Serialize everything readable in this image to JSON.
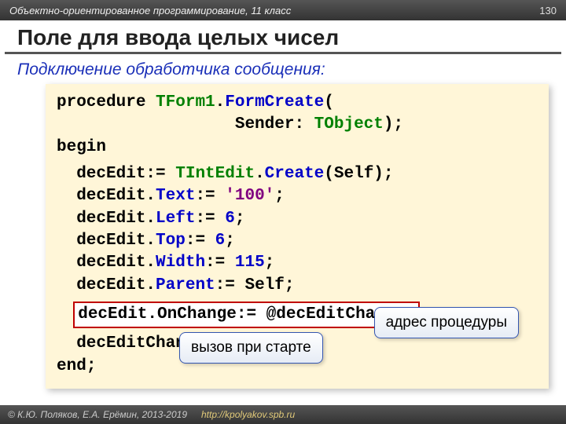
{
  "header": {
    "course": "Объектно-ориентированное программирование, 11 класс",
    "page_number": "130"
  },
  "title": "Поле для ввода целых чисел",
  "subtitle": "Подключение обработчика сообщения:",
  "code": {
    "kw_procedure": "procedure",
    "cls_tform1": "TForm1",
    "meth_formcreate": "FormCreate",
    "open_paren": "(",
    "param_indent": "                  Sender: ",
    "cls_tobject": "TObject",
    "close_paren": ");",
    "kw_begin": "begin",
    "l1a": "  decEdit:= ",
    "l1b": "TIntEdit",
    "l1c": ".",
    "l1d": "Create",
    "l1e": "(Self);",
    "l2a": "  decEdit.",
    "l2b": "Text",
    "l2c": ":= ",
    "l2d": "'100'",
    "l2e": ";",
    "l3a": "  decEdit.",
    "l3b": "Left",
    "l3c": ":= ",
    "l3d": "6",
    "l3e": ";",
    "l4a": "  decEdit.",
    "l4b": "Top",
    "l4c": ":= ",
    "l4d": "6",
    "l4e": ";",
    "l5a": "  decEdit.",
    "l5b": "Width",
    "l5c": ":= ",
    "l5d": "115",
    "l5e": ";",
    "l6a": "  decEdit.",
    "l6b": "Parent",
    "l6c": ":= Self;",
    "hl": "decEdit.OnChange:= @decEditChange;",
    "l8": "  decEditChange(Sender);",
    "kw_end": "end",
    "semi": ";"
  },
  "callouts": {
    "address": "адрес процедуры",
    "startup": "вызов при старте"
  },
  "footer": {
    "copyright": "© К.Ю. Поляков, Е.А. Ерёмин, 2013-2019",
    "link": "http://kpolyakov.spb.ru"
  }
}
